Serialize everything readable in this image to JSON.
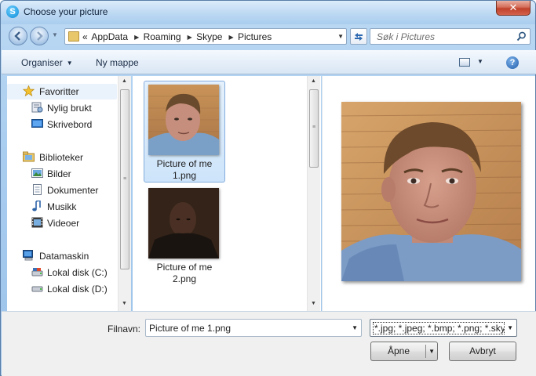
{
  "window": {
    "title": "Choose your picture",
    "close_glyph": "✕"
  },
  "nav": {
    "breadcrumb_prefix": "«",
    "breadcrumbs": [
      "AppData",
      "Roaming",
      "Skype",
      "Pictures"
    ],
    "search_placeholder": "Søk i Pictures"
  },
  "toolbar": {
    "organise_label": "Organiser",
    "new_folder_label": "Ny mappe",
    "help_glyph": "?"
  },
  "sidebar": {
    "items": [
      {
        "label": "Favoritter",
        "icon": "star-icon"
      },
      {
        "label": "Nylig brukt",
        "icon": "recent-places-icon"
      },
      {
        "label": "Skrivebord",
        "icon": "desktop-icon"
      },
      {
        "label": "Biblioteker",
        "icon": "libraries-icon"
      },
      {
        "label": "Bilder",
        "icon": "pictures-icon"
      },
      {
        "label": "Dokumenter",
        "icon": "documents-icon"
      },
      {
        "label": "Musikk",
        "icon": "music-icon"
      },
      {
        "label": "Videoer",
        "icon": "videos-icon"
      },
      {
        "label": "Datamaskin",
        "icon": "computer-icon"
      },
      {
        "label": "Lokal disk (C:)",
        "icon": "drive-c-icon"
      },
      {
        "label": "Lokal disk (D:)",
        "icon": "drive-d-icon"
      }
    ]
  },
  "files": [
    {
      "name": "Picture of me 1.png",
      "selected": true
    },
    {
      "name": "Picture of me 2.png",
      "selected": false
    }
  ],
  "bottom": {
    "filename_label": "Filnavn:",
    "filename_value": "Picture of me 1.png",
    "filetype_value": "*.jpg; *.jpeg; *.bmp; *.png; *.sky",
    "open_label": "Åpne",
    "cancel_label": "Avbryt"
  }
}
